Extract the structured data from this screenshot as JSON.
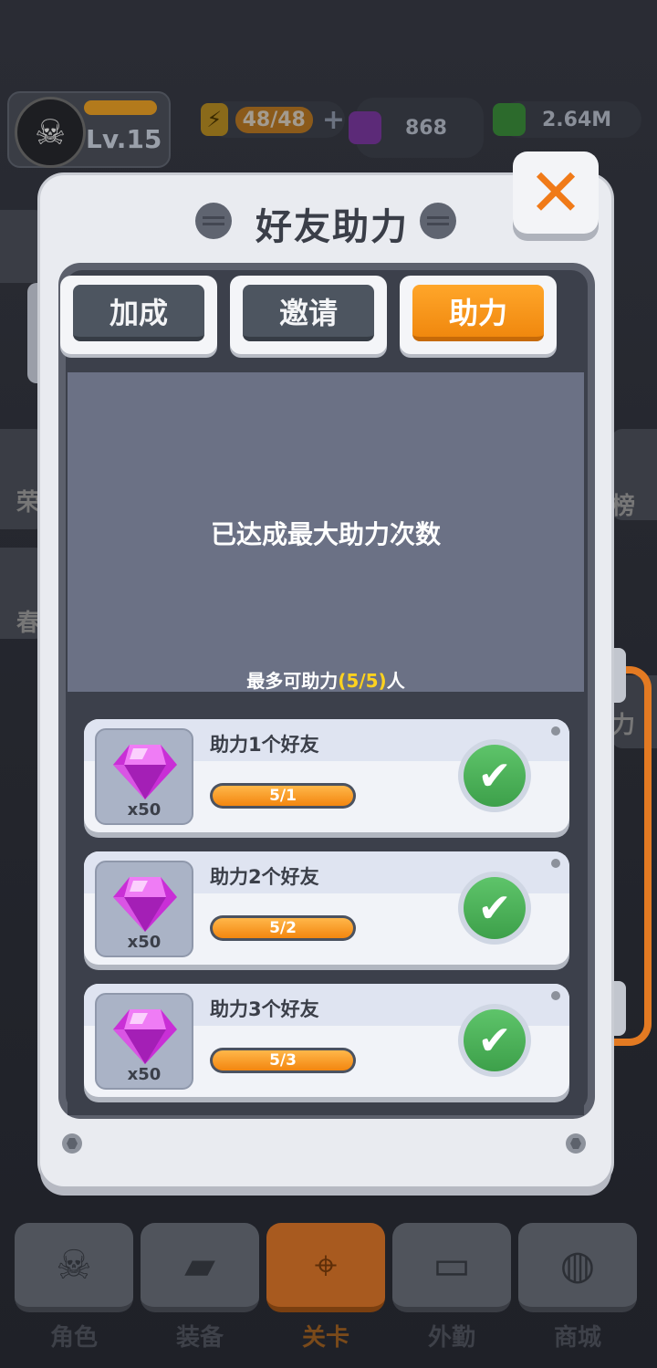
{
  "top_bar": {
    "level": "Lv.15",
    "energy": "48/48",
    "gems": "868",
    "cash": "2.64M"
  },
  "modal": {
    "title": "好友助力",
    "close_icon": "close-x-icon",
    "tabs": [
      {
        "label": "加成",
        "active": false
      },
      {
        "label": "邀请",
        "active": false
      },
      {
        "label": "助力",
        "active": true
      }
    ],
    "status_message": "已达成最大助力次数",
    "limit_prefix": "最多可助力",
    "limit_value": "(5/5)",
    "limit_suffix": "人",
    "rewards": [
      {
        "title": "助力1个好友",
        "reward_icon": "gem-icon",
        "reward_qty": "x50",
        "progress_text": "5/1",
        "progress": 1.0,
        "claimed": true
      },
      {
        "title": "助力2个好友",
        "reward_icon": "gem-icon",
        "reward_qty": "x50",
        "progress_text": "5/2",
        "progress": 1.0,
        "claimed": true
      },
      {
        "title": "助力3个好友",
        "reward_icon": "gem-icon",
        "reward_qty": "x50",
        "progress_text": "5/3",
        "progress": 1.0,
        "claimed": true
      }
    ]
  },
  "background": {
    "side_left": [
      "荣",
      "春"
    ],
    "side_right": [
      "榜",
      "力"
    ]
  },
  "bottom_nav": [
    {
      "label": "角色",
      "icon": "skull-icon",
      "active": false
    },
    {
      "label": "装备",
      "icon": "gun-icon",
      "active": false
    },
    {
      "label": "关卡",
      "icon": "map-pin-icon",
      "active": true
    },
    {
      "label": "外勤",
      "icon": "gamepad-icon",
      "active": false
    },
    {
      "label": "商城",
      "icon": "shop-icon",
      "active": false
    }
  ],
  "colors": {
    "accent_orange": "#f0880e",
    "check_green": "#3da04a",
    "highlight_yellow": "#ffd21f"
  }
}
